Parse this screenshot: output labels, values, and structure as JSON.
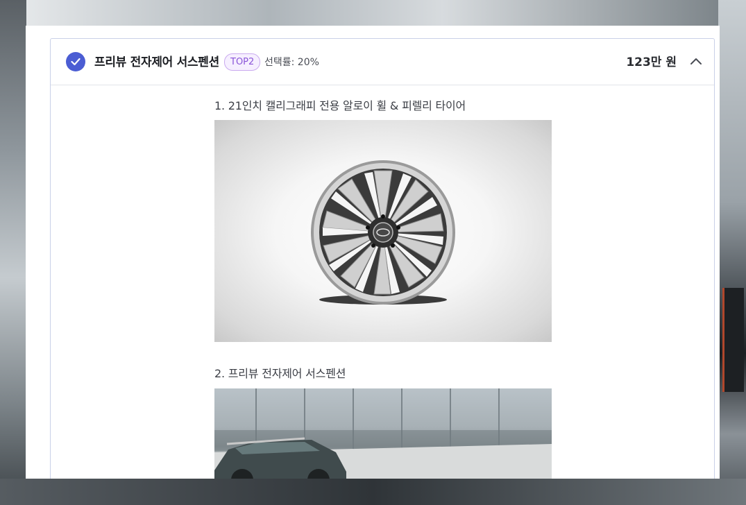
{
  "option": {
    "title": "프리뷰 전자제어 서스펜션",
    "badge": "TOP2",
    "rate": "선택률: 20%",
    "price": "123만 원",
    "selected": true
  },
  "items": [
    {
      "label": "1. 21인치 캘리그래피 전용 알로이 휠 & 피렐리 타이어",
      "image": "alloy-wheel"
    },
    {
      "label": "2. 프리뷰 전자제어 서스펜션",
      "image": "suv-car"
    }
  ],
  "colors": {
    "accent": "#4b5dd3",
    "badge_text": "#8a55d8",
    "badge_bg": "#f6efff",
    "card_border": "#c9d0e8"
  },
  "icons": {
    "selected": "check-icon",
    "collapse": "chevron-up-icon"
  }
}
